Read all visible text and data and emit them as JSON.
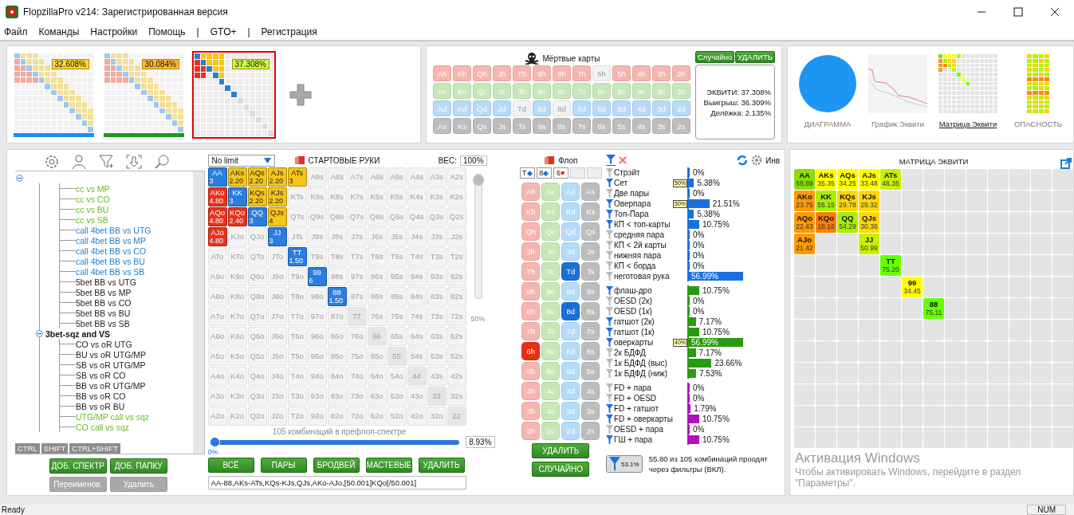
{
  "window": {
    "title": "FlopzillaPro v214: Зарегистрированная версия"
  },
  "menu": [
    {
      "label": "Файл"
    },
    {
      "label": "Команды"
    },
    {
      "label": "Настройки"
    },
    {
      "label": "Помощь"
    },
    {
      "label": "|"
    },
    {
      "label": "GTO+"
    },
    {
      "label": "|"
    },
    {
      "label": "Регистрация"
    }
  ],
  "ranges": [
    {
      "equity": "32.608%",
      "color": "#ffd633",
      "bar": {
        "color": "#1c8ff0"
      },
      "selected": false
    },
    {
      "equity": "30.084%",
      "color": "#ffb833",
      "bar": {
        "color": "#1a9a1a"
      },
      "selected": false
    },
    {
      "equity": "37.308%",
      "color": "#ccff44",
      "selected": true
    }
  ],
  "dead_cards": {
    "title": "Мёртвые карты",
    "buttons": [
      "Случайно",
      "УДАЛИТЬ"
    ],
    "rows": [
      [
        {
          "label": "Ah",
          "disabled": false
        },
        {
          "label": "Kh",
          "disabled": false
        },
        {
          "label": "Qh",
          "disabled": false
        },
        {
          "label": "Jh",
          "disabled": false
        },
        {
          "label": "Th",
          "disabled": false
        },
        {
          "label": "9h",
          "disabled": false
        },
        {
          "label": "8h",
          "disabled": false
        },
        {
          "label": "7h",
          "disabled": false
        },
        {
          "label": "6h",
          "disabled": true
        },
        {
          "label": "5h",
          "disabled": false
        },
        {
          "label": "4h",
          "disabled": false
        },
        {
          "label": "3h",
          "disabled": false
        },
        {
          "label": "2h",
          "disabled": false
        }
      ],
      [
        {
          "label": "Ac",
          "disabled": false
        },
        {
          "label": "Kc",
          "disabled": false
        },
        {
          "label": "Qc",
          "disabled": false
        },
        {
          "label": "Jc",
          "disabled": false
        },
        {
          "label": "Tc",
          "disabled": false
        },
        {
          "label": "9c",
          "disabled": false
        },
        {
          "label": "8c",
          "disabled": false
        },
        {
          "label": "7c",
          "disabled": false
        },
        {
          "label": "6c",
          "disabled": false
        },
        {
          "label": "5c",
          "disabled": false
        },
        {
          "label": "4c",
          "disabled": false
        },
        {
          "label": "3c",
          "disabled": false
        },
        {
          "label": "2c",
          "disabled": false
        }
      ],
      [
        {
          "label": "Ad",
          "disabled": false
        },
        {
          "label": "Kd",
          "disabled": false
        },
        {
          "label": "Qd",
          "disabled": false
        },
        {
          "label": "Jd",
          "disabled": false
        },
        {
          "label": "Td",
          "disabled": true
        },
        {
          "label": "9d",
          "disabled": false
        },
        {
          "label": "8d",
          "disabled": true
        },
        {
          "label": "7d",
          "disabled": false
        },
        {
          "label": "6d",
          "disabled": false
        },
        {
          "label": "5d",
          "disabled": false
        },
        {
          "label": "4d",
          "disabled": false
        },
        {
          "label": "3d",
          "disabled": false
        },
        {
          "label": "2d",
          "disabled": false
        }
      ],
      [
        {
          "label": "As",
          "disabled": false
        },
        {
          "label": "Ks",
          "disabled": false
        },
        {
          "label": "Qs",
          "disabled": false
        },
        {
          "label": "Js",
          "disabled": false
        },
        {
          "label": "Ts",
          "disabled": false
        },
        {
          "label": "9s",
          "disabled": false
        },
        {
          "label": "8s",
          "disabled": false
        },
        {
          "label": "7s",
          "disabled": false
        },
        {
          "label": "6s",
          "disabled": false
        },
        {
          "label": "5s",
          "disabled": false
        },
        {
          "label": "4s",
          "disabled": false
        },
        {
          "label": "3s",
          "disabled": false
        },
        {
          "label": "2s",
          "disabled": false
        }
      ]
    ],
    "stats": [
      "ЭКВИТИ: 37.308%",
      "Выигрыш: 36.309%",
      "Делёжка: 2.135%"
    ]
  },
  "views": [
    {
      "label": "ДИАГРАММА",
      "selected": false
    },
    {
      "label": "График Эквити",
      "selected": false
    },
    {
      "label": "Матрица Эквити",
      "selected": true
    },
    {
      "label": "ОПАСНОСТЬ",
      "selected": false
    }
  ],
  "tree": {
    "expanded": true,
    "children": [
      {
        "children": [
          {
            "label": "cc vs MP",
            "color": "#66bb22"
          },
          {
            "label": "cc vs CO",
            "color": "#66bb22"
          },
          {
            "label": "cc vs BU",
            "color": "#66bb22"
          },
          {
            "label": "cc vs SB",
            "color": "#66bb22"
          },
          {
            "label": "call 4bet BB vs UTG",
            "color": "#1e7fd0"
          },
          {
            "label": "call 4bet BB vs MP",
            "color": "#1e7fd0"
          },
          {
            "label": "call 4bet BB vs CO",
            "color": "#1e7fd0"
          },
          {
            "label": "call 4bet BB vs BU",
            "color": "#1e7fd0"
          },
          {
            "label": "call 4bet BB vs SB",
            "color": "#1e7fd0"
          },
          {
            "label": "5bet BB vs UTG",
            "color": "#222222"
          },
          {
            "label": "5bet BB vs MP",
            "color": "#222222"
          },
          {
            "label": "5bet BB vs CO",
            "color": "#222222"
          },
          {
            "label": "5bet BB vs BU",
            "color": "#222222"
          },
          {
            "label": "5bet BB vs SB",
            "color": "#222222"
          }
        ]
      },
      {
        "label": "3bet-sqz and VS",
        "expanded": true,
        "children": [
          {
            "label": "CO vs oR UTG",
            "color": "#222222"
          },
          {
            "label": "BU vs oR UTG/MP",
            "color": "#222222"
          },
          {
            "label": "SB vs oR UTG/MP",
            "color": "#222222"
          },
          {
            "label": "SB vs oR CO",
            "color": "#222222"
          },
          {
            "label": "BB vs oR UTG/MP",
            "color": "#222222"
          },
          {
            "label": "BB vs oR CO",
            "color": "#222222"
          },
          {
            "label": "BB vs oR BU",
            "color": "#222222"
          },
          {
            "label": "UTG/MP call vs sqz",
            "color": "#66bb22"
          },
          {
            "label": "CO call vs sqz",
            "color": "#66bb22"
          }
        ]
      }
    ]
  },
  "modifier_keys": [
    "CTRL",
    "SHIFT",
    "CTRL+SHIFT"
  ],
  "tree_buttons": [
    {
      "label": "ДОБ. СПЕКТР",
      "disabled": false
    },
    {
      "label": "ДОБ. ПАПКУ",
      "disabled": false
    },
    {
      "label": "Переименов.",
      "disabled": true
    },
    {
      "label": "Удалить",
      "disabled": true
    }
  ],
  "hands": {
    "game": "No limit",
    "title": "СТАРТОВЫЕ РУКИ",
    "weight_label": "ВЕС:",
    "weight": "100%",
    "weight_slider": {
      "level": 1
    },
    "weight_mark": "50%",
    "rows": [
      [
        {
          "label": "AA",
          "selected": true,
          "weight": "3"
        },
        {
          "label": "AKs",
          "selected": true,
          "weight": "2.20"
        },
        {
          "label": "AQs",
          "selected": true,
          "weight": "2.20"
        },
        {
          "label": "AJs",
          "selected": true,
          "weight": "2.20"
        },
        {
          "label": "ATs",
          "selected": true,
          "weight": "3"
        },
        {
          "label": "A9s",
          "selected": false
        },
        {
          "label": "A8s",
          "selected": false
        },
        {
          "label": "A7s",
          "selected": false
        },
        {
          "label": "A6s",
          "selected": false
        },
        {
          "label": "A5s",
          "selected": false
        },
        {
          "label": "A4s",
          "selected": false
        },
        {
          "label": "A3s",
          "selected": false
        },
        {
          "label": "A2s",
          "selected": false
        }
      ],
      [
        {
          "label": "AKo",
          "selected": true,
          "weight": "4.80"
        },
        {
          "label": "KK",
          "selected": true,
          "weight": "3"
        },
        {
          "label": "KQs",
          "selected": true,
          "weight": "2.20"
        },
        {
          "label": "KJs",
          "selected": true,
          "weight": "2.20"
        },
        {
          "label": "KTs",
          "selected": false
        },
        {
          "label": "K9s",
          "selected": false
        },
        {
          "label": "K8s",
          "selected": false
        },
        {
          "label": "K7s",
          "selected": false
        },
        {
          "label": "K6s",
          "selected": false
        },
        {
          "label": "K5s",
          "selected": false
        },
        {
          "label": "K4s",
          "selected": false
        },
        {
          "label": "K3s",
          "selected": false
        },
        {
          "label": "K2s",
          "selected": false
        }
      ],
      [
        {
          "label": "AQo",
          "selected": true,
          "weight": "4.80"
        },
        {
          "label": "KQo",
          "selected": true,
          "weight": "2.40"
        },
        {
          "label": "QQ",
          "selected": true,
          "weight": "3"
        },
        {
          "label": "QJs",
          "selected": true,
          "weight": "4"
        },
        {
          "label": "QTs",
          "selected": false
        },
        {
          "label": "Q9s",
          "selected": false
        },
        {
          "label": "Q8s",
          "selected": false
        },
        {
          "label": "Q7s",
          "selected": false
        },
        {
          "label": "Q6s",
          "selected": false
        },
        {
          "label": "Q5s",
          "selected": false
        },
        {
          "label": "Q4s",
          "selected": false
        },
        {
          "label": "Q3s",
          "selected": false
        },
        {
          "label": "Q2s",
          "selected": false
        }
      ],
      [
        {
          "label": "AJo",
          "selected": true,
          "weight": "4.80"
        },
        {
          "label": "KJo",
          "selected": false
        },
        {
          "label": "QJo",
          "selected": false
        },
        {
          "label": "JJ",
          "selected": true,
          "weight": "3"
        },
        {
          "label": "JTs",
          "selected": false
        },
        {
          "label": "J9s",
          "selected": false
        },
        {
          "label": "J8s",
          "selected": false
        },
        {
          "label": "J7s",
          "selected": false
        },
        {
          "label": "J6s",
          "selected": false
        },
        {
          "label": "J5s",
          "selected": false
        },
        {
          "label": "J4s",
          "selected": false
        },
        {
          "label": "J3s",
          "selected": false
        },
        {
          "label": "J2s",
          "selected": false
        }
      ],
      [
        {
          "label": "ATo",
          "selected": false
        },
        {
          "label": "KTo",
          "selected": false
        },
        {
          "label": "QTo",
          "selected": false
        },
        {
          "label": "JTo",
          "selected": false
        },
        {
          "label": "TT",
          "selected": true,
          "weight": "1.50"
        },
        {
          "label": "T9s",
          "selected": false
        },
        {
          "label": "T8s",
          "selected": false
        },
        {
          "label": "T7s",
          "selected": false
        },
        {
          "label": "T6s",
          "selected": false
        },
        {
          "label": "T5s",
          "selected": false
        },
        {
          "label": "T4s",
          "selected": false
        },
        {
          "label": "T3s",
          "selected": false
        },
        {
          "label": "T2s",
          "selected": false
        }
      ],
      [
        {
          "label": "A9o",
          "selected": false
        },
        {
          "label": "K9o",
          "selected": false
        },
        {
          "label": "Q9o",
          "selected": false
        },
        {
          "label": "J9o",
          "selected": false
        },
        {
          "label": "T9o",
          "selected": false
        },
        {
          "label": "99",
          "selected": true,
          "weight": "6"
        },
        {
          "label": "98s",
          "selected": false
        },
        {
          "label": "97s",
          "selected": false
        },
        {
          "label": "96s",
          "selected": false
        },
        {
          "label": "95s",
          "selected": false
        },
        {
          "label": "94s",
          "selected": false
        },
        {
          "label": "93s",
          "selected": false
        },
        {
          "label": "92s",
          "selected": false
        }
      ],
      [
        {
          "label": "A8o",
          "selected": false
        },
        {
          "label": "K8o",
          "selected": false
        },
        {
          "label": "Q8o",
          "selected": false
        },
        {
          "label": "J8o",
          "selected": false
        },
        {
          "label": "T8o",
          "selected": false
        },
        {
          "label": "98o",
          "selected": false
        },
        {
          "label": "88",
          "selected": true,
          "weight": "1.50"
        },
        {
          "label": "87s",
          "selected": false
        },
        {
          "label": "86s",
          "selected": false
        },
        {
          "label": "85s",
          "selected": false
        },
        {
          "label": "84s",
          "selected": false
        },
        {
          "label": "83s",
          "selected": false
        },
        {
          "label": "82s",
          "selected": false
        }
      ],
      [
        {
          "label": "A7o",
          "selected": false
        },
        {
          "label": "K7o",
          "selected": false
        },
        {
          "label": "Q7o",
          "selected": false
        },
        {
          "label": "J7o",
          "selected": false
        },
        {
          "label": "T7o",
          "selected": false
        },
        {
          "label": "97o",
          "selected": false
        },
        {
          "label": "87o",
          "selected": false
        },
        {
          "label": "77",
          "selected": false
        },
        {
          "label": "76s",
          "selected": false
        },
        {
          "label": "75s",
          "selected": false
        },
        {
          "label": "74s",
          "selected": false
        },
        {
          "label": "73s",
          "selected": false
        },
        {
          "label": "72s",
          "selected": false
        }
      ],
      [
        {
          "label": "A6o",
          "selected": false
        },
        {
          "label": "K6o",
          "selected": false
        },
        {
          "label": "Q6o",
          "selected": false
        },
        {
          "label": "J6o",
          "selected": false
        },
        {
          "label": "T6o",
          "selected": false
        },
        {
          "label": "96o",
          "selected": false
        },
        {
          "label": "86o",
          "selected": false
        },
        {
          "label": "76o",
          "selected": false
        },
        {
          "label": "66",
          "selected": false
        },
        {
          "label": "65s",
          "selected": false
        },
        {
          "label": "64s",
          "selected": false
        },
        {
          "label": "63s",
          "selected": false
        },
        {
          "label": "62s",
          "selected": false
        }
      ],
      [
        {
          "label": "A5o",
          "selected": false
        },
        {
          "label": "K5o",
          "selected": false
        },
        {
          "label": "Q5o",
          "selected": false
        },
        {
          "label": "J5o",
          "selected": false
        },
        {
          "label": "T5o",
          "selected": false
        },
        {
          "label": "95o",
          "selected": false
        },
        {
          "label": "85o",
          "selected": false
        },
        {
          "label": "75o",
          "selected": false
        },
        {
          "label": "65o",
          "selected": false
        },
        {
          "label": "55",
          "selected": false
        },
        {
          "label": "54s",
          "selected": false
        },
        {
          "label": "53s",
          "selected": false
        },
        {
          "label": "52s",
          "selected": false
        }
      ],
      [
        {
          "label": "A4o",
          "selected": false
        },
        {
          "label": "K4o",
          "selected": false
        },
        {
          "label": "Q4o",
          "selected": false
        },
        {
          "label": "J4o",
          "selected": false
        },
        {
          "label": "T4o",
          "selected": false
        },
        {
          "label": "94o",
          "selected": false
        },
        {
          "label": "84o",
          "selected": false
        },
        {
          "label": "74o",
          "selected": false
        },
        {
          "label": "64o",
          "selected": false
        },
        {
          "label": "54o",
          "selected": false
        },
        {
          "label": "44",
          "selected": false
        },
        {
          "label": "43s",
          "selected": false
        },
        {
          "label": "42s",
          "selected": false
        }
      ],
      [
        {
          "label": "A3o",
          "selected": false
        },
        {
          "label": "K3o",
          "selected": false
        },
        {
          "label": "Q3o",
          "selected": false
        },
        {
          "label": "J3o",
          "selected": false
        },
        {
          "label": "T3o",
          "selected": false
        },
        {
          "label": "93o",
          "selected": false
        },
        {
          "label": "83o",
          "selected": false
        },
        {
          "label": "73o",
          "selected": false
        },
        {
          "label": "63o",
          "selected": false
        },
        {
          "label": "53o",
          "selected": false
        },
        {
          "label": "43o",
          "selected": false
        },
        {
          "label": "33",
          "selected": false
        },
        {
          "label": "32s",
          "selected": false
        }
      ],
      [
        {
          "label": "A2o",
          "selected": false
        },
        {
          "label": "K2o",
          "selected": false
        },
        {
          "label": "Q2o",
          "selected": false
        },
        {
          "label": "J2o",
          "selected": false
        },
        {
          "label": "T2o",
          "selected": false
        },
        {
          "label": "92o",
          "selected": false
        },
        {
          "label": "82o",
          "selected": false
        },
        {
          "label": "72o",
          "selected": false
        },
        {
          "label": "62o",
          "selected": false
        },
        {
          "label": "52o",
          "selected": false
        },
        {
          "label": "42o",
          "selected": false
        },
        {
          "label": "32o",
          "selected": false
        },
        {
          "label": "22",
          "selected": false
        }
      ]
    ],
    "combos": "105 комбинаций в префлоп-спектре",
    "slider_min": "0%",
    "range_slider": {
      "level": 0
    },
    "percent": "8.93%",
    "buttons": [
      "ВСЁ",
      "ПАРЫ",
      "БРОДВЕЙ",
      "МАСТЕВЫЕ",
      "УДАЛИТЬ"
    ],
    "range_text": "AA-88,AKs-ATs,KQs-KJs,QJs,AKo-AJo,[50.001]KQo[/50.001]"
  },
  "flop": {
    "title": "Флоп",
    "board": [
      {
        "filled": true,
        "rank": "T",
        "suit": "◆",
        "color": "#1a6fd6"
      },
      {
        "filled": true,
        "rank": "8",
        "suit": "◆",
        "color": "#1a6fd6"
      },
      {
        "filled": true,
        "rank": "6",
        "suit": "♥",
        "color": "#e01010"
      },
      {
        "filled": false
      },
      {
        "filled": false
      }
    ],
    "rows": [
      [
        {
          "label": "Ah",
          "selected": false
        },
        {
          "label": "Ac",
          "selected": false
        },
        {
          "label": "Ad",
          "selected": false
        },
        {
          "label": "As",
          "selected": false
        }
      ],
      [
        {
          "label": "Kh",
          "selected": false
        },
        {
          "label": "Kc",
          "selected": false
        },
        {
          "label": "Kd",
          "selected": false
        },
        {
          "label": "Ks",
          "selected": false
        }
      ],
      [
        {
          "label": "Qh",
          "selected": false
        },
        {
          "label": "Qc",
          "selected": false
        },
        {
          "label": "Qd",
          "selected": false
        },
        {
          "label": "Qs",
          "selected": false
        }
      ],
      [
        {
          "label": "Jh",
          "selected": false
        },
        {
          "label": "Jc",
          "selected": false
        },
        {
          "label": "Jd",
          "selected": false
        },
        {
          "label": "Js",
          "selected": false
        }
      ],
      [
        {
          "label": "Th",
          "selected": false
        },
        {
          "label": "Tc",
          "selected": false
        },
        {
          "label": "Td",
          "selected": true
        },
        {
          "label": "Ts",
          "selected": false
        }
      ],
      [
        {
          "label": "9h",
          "selected": false
        },
        {
          "label": "9c",
          "selected": false
        },
        {
          "label": "9d",
          "selected": false
        },
        {
          "label": "9s",
          "selected": false
        }
      ],
      [
        {
          "label": "8h",
          "selected": false
        },
        {
          "label": "8c",
          "selected": false
        },
        {
          "label": "8d",
          "selected": true
        },
        {
          "label": "8s",
          "selected": false
        }
      ],
      [
        {
          "label": "7h",
          "selected": false
        },
        {
          "label": "7c",
          "selected": false
        },
        {
          "label": "7d",
          "selected": false
        },
        {
          "label": "7s",
          "selected": false
        }
      ],
      [
        {
          "label": "6h",
          "selected": true
        },
        {
          "label": "6c",
          "selected": false
        },
        {
          "label": "6d",
          "selected": false
        },
        {
          "label": "6s",
          "selected": false
        }
      ],
      [
        {
          "label": "5h",
          "selected": false
        },
        {
          "label": "5c",
          "selected": false
        },
        {
          "label": "5d",
          "selected": false
        },
        {
          "label": "5s",
          "selected": false
        }
      ],
      [
        {
          "label": "4h",
          "selected": false
        },
        {
          "label": "4c",
          "selected": false
        },
        {
          "label": "4d",
          "selected": false
        },
        {
          "label": "4s",
          "selected": false
        }
      ],
      [
        {
          "label": "3h",
          "selected": false
        },
        {
          "label": "3c",
          "selected": false
        },
        {
          "label": "3d",
          "selected": false
        },
        {
          "label": "3s",
          "selected": false
        }
      ],
      [
        {
          "label": "2h",
          "selected": false
        },
        {
          "label": "2c",
          "selected": false
        },
        {
          "label": "2d",
          "selected": false
        },
        {
          "label": "2s",
          "selected": false
        }
      ]
    ],
    "buttons": [
      "УДАЛИТЬ",
      "СЛУЧАЙНО"
    ]
  },
  "filters": {
    "invert_label": "Инв",
    "groups": [
      {
        "color": "#1a6fe0",
        "items": [
          {
            "label": "Стрэйт",
            "active": false,
            "value": "0%",
            "level": 0
          },
          {
            "label": "Сет",
            "active": true,
            "badge": "50%",
            "value": "5.38%",
            "level": 0.0538
          },
          {
            "label": "Две пары",
            "active": false,
            "value": "0%",
            "level": 0
          },
          {
            "label": "Оверпара",
            "active": true,
            "badge": "50%",
            "value": "21.51%",
            "level": 0.2151
          },
          {
            "label": "Топ-Пара",
            "active": true,
            "value": "5.38%",
            "level": 0.0538
          },
          {
            "label": "КП < топ-карты",
            "active": true,
            "value": "10.75%",
            "level": 0.1075
          },
          {
            "label": "средняя пара",
            "active": false,
            "value": "0%",
            "level": 0
          },
          {
            "label": "КП < 2й карты",
            "active": false,
            "value": "0%",
            "level": 0
          },
          {
            "label": "нижняя пара",
            "active": false,
            "value": "0%",
            "level": 0
          },
          {
            "label": "КП < борда",
            "active": false,
            "value": "0%",
            "level": 0
          },
          {
            "label": "неготовая рука",
            "active": false,
            "value": "56.99%",
            "level": 0.5699
          }
        ]
      },
      {
        "color": "#2a9a10",
        "items": [
          {
            "label": "флаш-дро",
            "active": true,
            "value": "10.75%",
            "level": 0.1075
          },
          {
            "label": "OESD (2к)",
            "active": false,
            "value": "0%",
            "level": 0
          },
          {
            "label": "OESD (1к)",
            "active": false,
            "value": "0%",
            "level": 0
          },
          {
            "label": "гатшот (2к)",
            "active": true,
            "value": "7.17%",
            "level": 0.0717
          },
          {
            "label": "гатшот (1к)",
            "active": true,
            "value": "10.75%",
            "level": 0.1075
          },
          {
            "label": "оверкарты",
            "active": true,
            "badge": "40%",
            "value": "56.99%",
            "level": 0.5699
          },
          {
            "label": "2к БДФД",
            "active": false,
            "value": "7.17%",
            "level": 0.0717
          },
          {
            "label": "1к БДФД (выс)",
            "active": false,
            "value": "23.66%",
            "level": 0.2366
          },
          {
            "label": "1к БДФД (ниж)",
            "active": false,
            "value": "7.53%",
            "level": 0.0753
          }
        ]
      },
      {
        "color": "#b010c0",
        "items": [
          {
            "label": "FD + пара",
            "active": false,
            "value": "0%",
            "level": 0
          },
          {
            "label": "FD + OESD",
            "active": false,
            "value": "0%",
            "level": 0
          },
          {
            "label": "FD + гатшот",
            "active": true,
            "value": "1.79%",
            "level": 0.0179
          },
          {
            "label": "FD + оверкарты",
            "active": true,
            "value": "10.75%",
            "level": 0.1075
          },
          {
            "label": "OESD + пара",
            "active": false,
            "value": "0%",
            "level": 0
          },
          {
            "label": "ГШ + пара",
            "active": true,
            "value": "10.75%",
            "level": 0.1075
          }
        ]
      }
    ],
    "badge": "53.1%",
    "summary": "55.80 из 105 комбинаций проодят через фильтры (ВКЛ)."
  },
  "equity_matrix": {
    "title": "МАТРИЦА ЭКВИТИ",
    "rows": [
      [
        {
          "label": "AA",
          "equity": "58.89",
          "color": "#88e000"
        },
        {
          "label": "AKs",
          "equity": "35.35",
          "color": "#ffff00"
        },
        {
          "label": "AQs",
          "equity": "34.25",
          "color": "#ffff00"
        },
        {
          "label": "AJs",
          "equity": "33.48",
          "color": "#ffff00"
        },
        {
          "label": "ATs",
          "equity": "48.35",
          "color": "#c8f000"
        },
        null,
        null,
        null,
        null,
        null,
        null,
        null,
        null
      ],
      [
        {
          "label": "AKo",
          "equity": "23.75",
          "color": "#ff9900"
        },
        {
          "label": "KK",
          "equity": "55.15",
          "color": "#a8f000"
        },
        {
          "label": "KQs",
          "equity": "29.78",
          "color": "#ffd700"
        },
        {
          "label": "KJs",
          "equity": "29.32",
          "color": "#ffd700"
        },
        null,
        null,
        null,
        null,
        null,
        null,
        null,
        null,
        null
      ],
      [
        {
          "label": "AQo",
          "equity": "22.43",
          "color": "#ff9900"
        },
        {
          "label": "KQo",
          "equity": "18.16",
          "color": "#ff7f00"
        },
        {
          "label": "QQ",
          "equity": "54.29",
          "color": "#a8f000"
        },
        {
          "label": "QJs",
          "equity": "30.36",
          "color": "#ffd700"
        },
        null,
        null,
        null,
        null,
        null,
        null,
        null,
        null,
        null
      ],
      [
        {
          "label": "AJo",
          "equity": "21.42",
          "color": "#ff9900"
        },
        null,
        null,
        {
          "label": "JJ",
          "equity": "50.99",
          "color": "#c8f000"
        },
        null,
        null,
        null,
        null,
        null,
        null,
        null,
        null,
        null
      ],
      [
        null,
        null,
        null,
        null,
        {
          "label": "TT",
          "equity": "75.20",
          "color": "#66ff00"
        },
        null,
        null,
        null,
        null,
        null,
        null,
        null,
        null
      ],
      [
        null,
        null,
        null,
        null,
        null,
        {
          "label": "99",
          "equity": "34.45",
          "color": "#ffff00"
        },
        null,
        null,
        null,
        null,
        null,
        null,
        null
      ],
      [
        null,
        null,
        null,
        null,
        null,
        null,
        {
          "label": "88",
          "equity": "75.11",
          "color": "#66ff00"
        },
        null,
        null,
        null,
        null,
        null,
        null
      ],
      [
        null,
        null,
        null,
        null,
        null,
        null,
        null,
        null,
        null,
        null,
        null,
        null,
        null
      ],
      [
        null,
        null,
        null,
        null,
        null,
        null,
        null,
        null,
        null,
        null,
        null,
        null,
        null
      ],
      [
        null,
        null,
        null,
        null,
        null,
        null,
        null,
        null,
        null,
        null,
        null,
        null,
        null
      ],
      [
        null,
        null,
        null,
        null,
        null,
        null,
        null,
        null,
        null,
        null,
        null,
        null,
        null
      ],
      [
        null,
        null,
        null,
        null,
        null,
        null,
        null,
        null,
        null,
        null,
        null,
        null,
        null
      ],
      [
        null,
        null,
        null,
        null,
        null,
        null,
        null,
        null,
        null,
        null,
        null,
        null,
        null
      ]
    ]
  },
  "activation": {
    "title": "Активация Windows",
    "text": "Чтобы активировать Windows, перейдите в раздел \"Параметры\"."
  },
  "status_bar": {
    "text": "Ready",
    "indicator": "NUM"
  }
}
